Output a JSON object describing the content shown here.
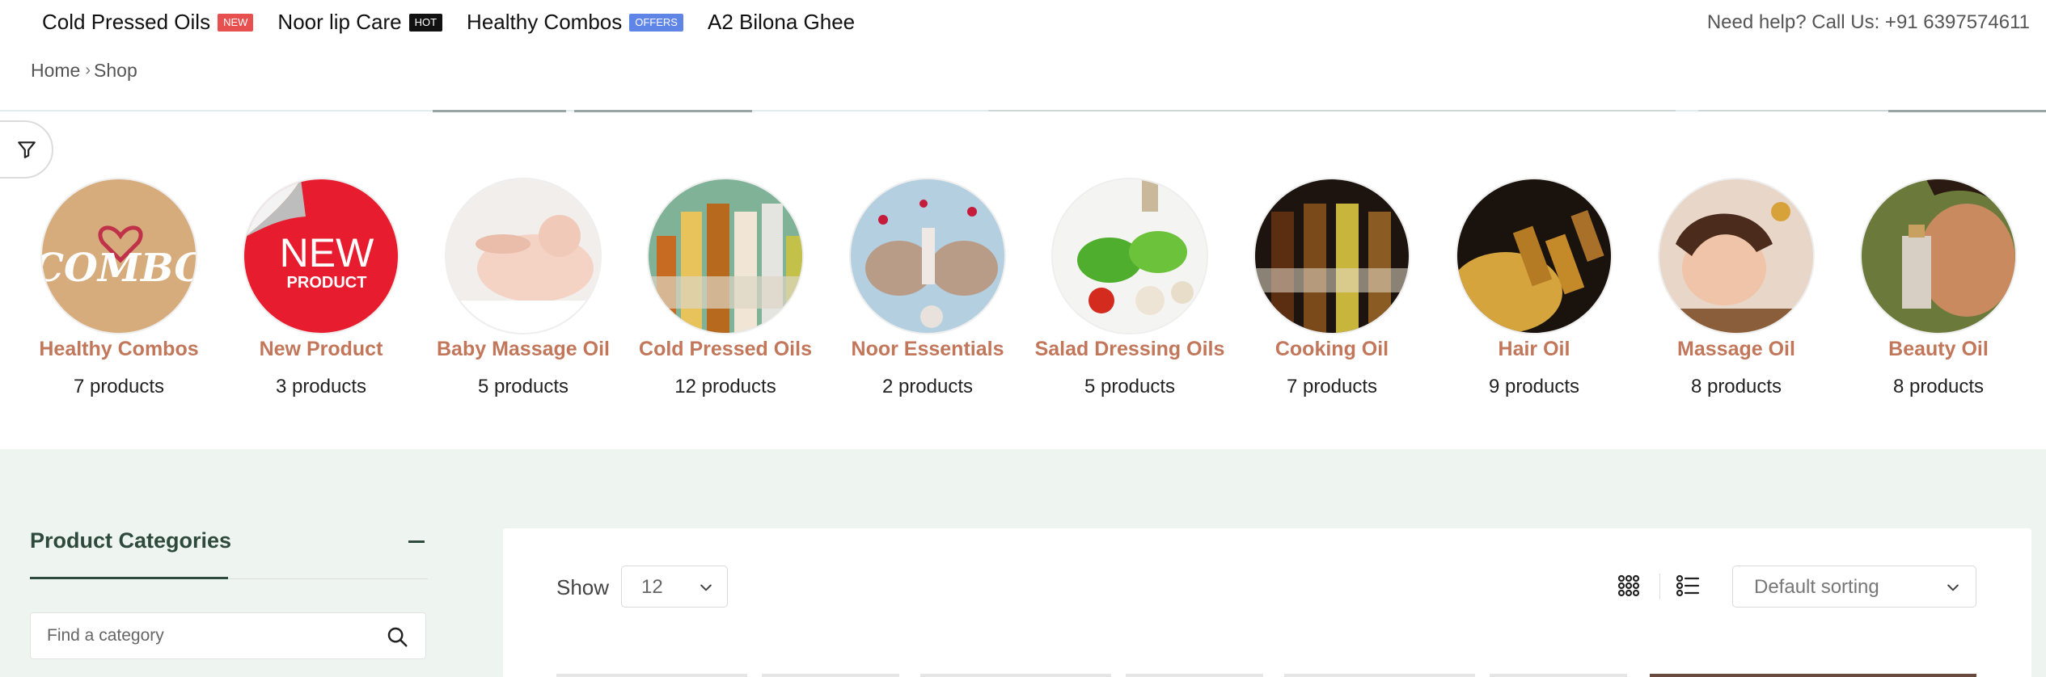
{
  "topnav": {
    "items": [
      {
        "label": "Cold Pressed Oils",
        "badge": "NEW"
      },
      {
        "label": "Noor lip Care",
        "badge": "HOT"
      },
      {
        "label": "Healthy Combos",
        "badge": "OFFERS"
      },
      {
        "label": "A2 Bilona Ghee",
        "badge": ""
      }
    ],
    "help": "Need help? Call Us: +91 6397574611"
  },
  "breadcrumb": {
    "home": "Home",
    "current": "Shop"
  },
  "categories": [
    {
      "name": "Healthy Combos",
      "count": "7 products"
    },
    {
      "name": "New Product",
      "count": "3 products"
    },
    {
      "name": "Baby Massage Oil",
      "count": "5 products"
    },
    {
      "name": "Cold Pressed Oils",
      "count": "12 products"
    },
    {
      "name": "Noor Essentials",
      "count": "2 products"
    },
    {
      "name": "Salad Dressing Oils",
      "count": "5 products"
    },
    {
      "name": "Cooking Oil",
      "count": "7 products"
    },
    {
      "name": "Hair Oil",
      "count": "9 products"
    },
    {
      "name": "Massage Oil",
      "count": "8 products"
    },
    {
      "name": "Beauty Oil",
      "count": "8 products"
    }
  ],
  "combo_image_text": "COMBO",
  "new_image_text": {
    "big": "NEW",
    "small": "PRODUCT"
  },
  "sidebar": {
    "title": "Product Categories",
    "search_placeholder": "Find a category"
  },
  "toolbar": {
    "show_label": "Show",
    "show_value": "12",
    "sort_value": "Default sorting"
  },
  "colors": {
    "category_name": "#c2765a",
    "brand_dark_green": "#2e4a3c",
    "shop_bg": "#eef4ef",
    "badge_new": "#e8504f",
    "badge_hot": "#111111",
    "badge_offers": "#5f86e6"
  }
}
